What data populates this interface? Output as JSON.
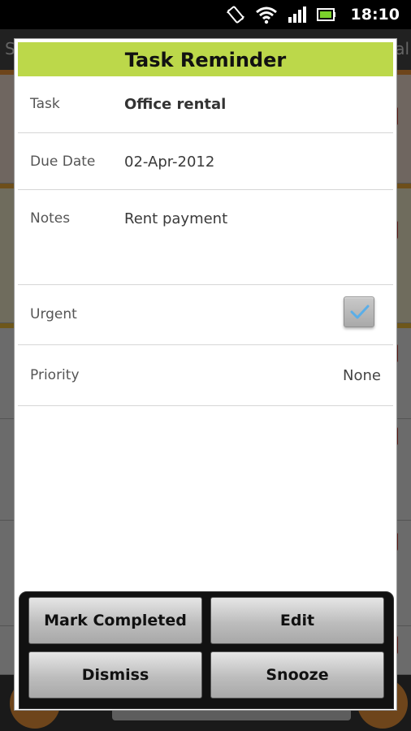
{
  "status_bar": {
    "time": "18:10",
    "icons": [
      "rotate-icon",
      "wifi-icon",
      "signal-icon",
      "battery-icon"
    ]
  },
  "background_app": {
    "left_text": "S",
    "right_text": "al"
  },
  "dialog": {
    "title": "Task Reminder",
    "task": {
      "label": "Task",
      "value": "Office rental"
    },
    "due_date": {
      "label": "Due Date",
      "value": "02-Apr-2012"
    },
    "notes": {
      "label": "Notes",
      "value": "Rent payment"
    },
    "urgent": {
      "label": "Urgent",
      "checked": true
    },
    "priority": {
      "label": "Priority",
      "value": "None"
    }
  },
  "buttons": {
    "mark_completed": "Mark Completed",
    "edit": "Edit",
    "dismiss": "Dismiss",
    "snooze": "Snooze"
  },
  "colors": {
    "title_bar": "#bcd84a",
    "accent_orange": "#f39a3c"
  }
}
